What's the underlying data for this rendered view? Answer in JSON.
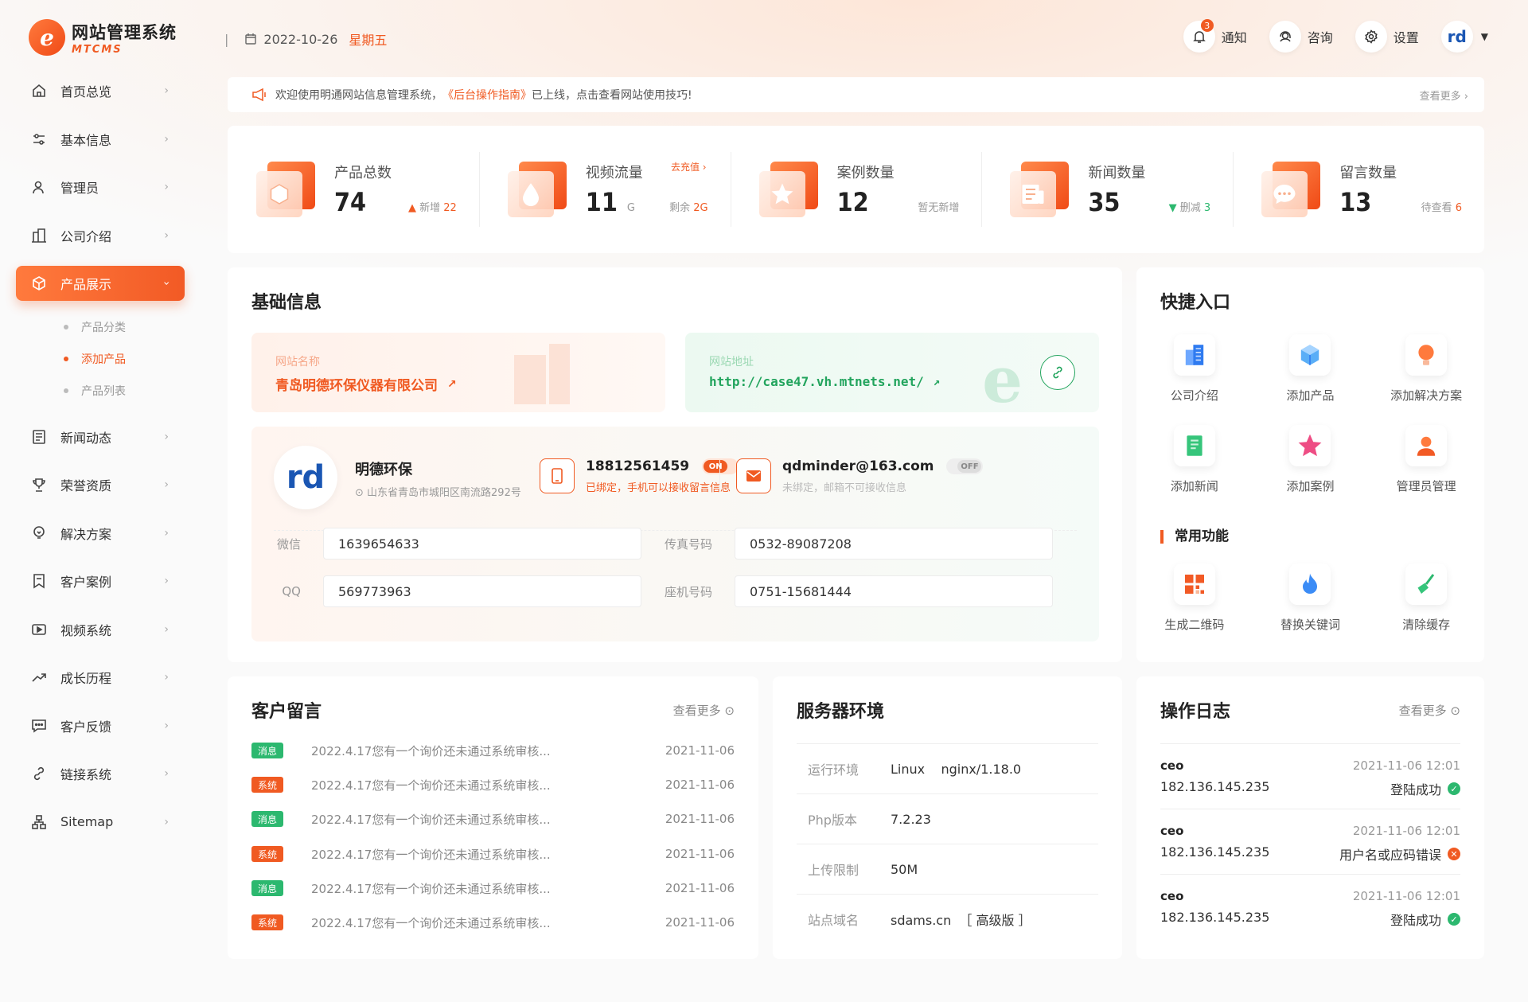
{
  "brand": {
    "title": "网站管理系统",
    "subtitle": "MTCMS",
    "mark": "e"
  },
  "sidebar": {
    "items": [
      {
        "label": "首页总览"
      },
      {
        "label": "基本信息"
      },
      {
        "label": "管理员"
      },
      {
        "label": "公司介绍"
      },
      {
        "label": "产品展示"
      },
      {
        "label": "新闻动态"
      },
      {
        "label": "荣誉资质"
      },
      {
        "label": "解决方案"
      },
      {
        "label": "客户案例"
      },
      {
        "label": "视频系统"
      },
      {
        "label": "成长历程"
      },
      {
        "label": "客户反馈"
      },
      {
        "label": "链接系统"
      },
      {
        "label": "Sitemap"
      }
    ],
    "sub_items": [
      {
        "label": "产品分类"
      },
      {
        "label": "添加产品"
      },
      {
        "label": "产品列表"
      }
    ]
  },
  "header": {
    "date": "2022-10-26",
    "weekday": "星期五",
    "notify_label": "通知",
    "notify_count": "3",
    "consult_label": "咨询",
    "settings_label": "设置",
    "avatar": "rd"
  },
  "notice": {
    "prefix": "欢迎使用明通网站信息管理系统，",
    "highlight": "《后台操作指南》",
    "suffix": "已上线，点击查看网站使用技巧!",
    "more": "查看更多"
  },
  "stats": [
    {
      "label": "产品总数",
      "value": "74",
      "unit": "",
      "side_label": "新增",
      "side_value": "22",
      "top_link": ""
    },
    {
      "label": "视频流量",
      "value": "11",
      "unit": "G",
      "side_label": "剩余",
      "side_value": "2G",
      "top_link": "去充值"
    },
    {
      "label": "案例数量",
      "value": "12",
      "unit": "",
      "side_label": "暂无新增",
      "side_value": "",
      "top_link": ""
    },
    {
      "label": "新闻数量",
      "value": "35",
      "unit": "",
      "side_label": "删减",
      "side_value": "3",
      "top_link": ""
    },
    {
      "label": "留言数量",
      "value": "13",
      "unit": "",
      "side_label": "待查看",
      "side_value": "6",
      "top_link": ""
    }
  ],
  "basic": {
    "title": "基础信息",
    "site_name_label": "网站名称",
    "site_name": "青岛明德环保仪器有限公司",
    "site_url_label": "网站地址",
    "site_url": "http://case47.vh.mtnets.net/",
    "company_logo": "rd",
    "company_name": "明德环保",
    "address": "山东省青岛市城阳区南流路292号",
    "phone": "18812561459",
    "phone_toggle": "ON",
    "phone_note": "已绑定，手机可以接收留言信息",
    "email": "qdminder@163.com",
    "email_toggle": "OFF",
    "email_note": "未绑定，邮箱不可接收信息",
    "fields": {
      "wechat_label": "微信",
      "wechat": "1639654633",
      "fax_label": "传真号码",
      "fax": "0532-89087208",
      "qq_label": "QQ",
      "qq": "569773963",
      "landline_label": "座机号码",
      "landline": "0751-15681444"
    }
  },
  "quick": {
    "title": "快捷入口",
    "items": [
      {
        "label": "公司介绍",
        "icon": "building-icon",
        "color": "#3b82f6"
      },
      {
        "label": "添加产品",
        "icon": "box-icon",
        "color": "#3b9cf6"
      },
      {
        "label": "添加解决方案",
        "icon": "bulb-icon",
        "color": "#f25a25"
      },
      {
        "label": "添加新闻",
        "icon": "document-icon",
        "color": "#2cb86f"
      },
      {
        "label": "添加案例",
        "icon": "star-icon",
        "color": "#ec4a7a"
      },
      {
        "label": "管理员管理",
        "icon": "user-icon",
        "color": "#f25a25"
      }
    ],
    "common_title": "常用功能",
    "common": [
      {
        "label": "生成二维码",
        "icon": "qrcode-icon",
        "color": "#f25a25"
      },
      {
        "label": "替换关键词",
        "icon": "flame-icon",
        "color": "#3b82f6"
      },
      {
        "label": "清除缓存",
        "icon": "broom-icon",
        "color": "#2cb86f"
      }
    ]
  },
  "messages": {
    "title": "客户留言",
    "more": "查看更多",
    "rows": [
      {
        "tag": "消息",
        "type": "green",
        "text": "2022.4.17您有一个询价还未通过系统审核...",
        "date": "2021-11-06"
      },
      {
        "tag": "系统",
        "type": "orange",
        "text": "2022.4.17您有一个询价还未通过系统审核...",
        "date": "2021-11-06"
      },
      {
        "tag": "消息",
        "type": "green",
        "text": "2022.4.17您有一个询价还未通过系统审核...",
        "date": "2021-11-06"
      },
      {
        "tag": "系统",
        "type": "orange",
        "text": "2022.4.17您有一个询价还未通过系统审核...",
        "date": "2021-11-06"
      },
      {
        "tag": "消息",
        "type": "green",
        "text": "2022.4.17您有一个询价还未通过系统审核...",
        "date": "2021-11-06"
      },
      {
        "tag": "系统",
        "type": "orange",
        "text": "2022.4.17您有一个询价还未通过系统审核...",
        "date": "2021-11-06"
      }
    ]
  },
  "server": {
    "title": "服务器环境",
    "rows": [
      {
        "key": "运行环境",
        "value": "Linux    nginx/1.18.0"
      },
      {
        "key": "Php版本",
        "value": "7.2.23"
      },
      {
        "key": "上传限制",
        "value": "50M"
      },
      {
        "key": "站点域名",
        "value": "sdams.cn  ［ 高级版 ］"
      }
    ]
  },
  "logs": {
    "title": "操作日志",
    "more": "查看更多",
    "rows": [
      {
        "user": "ceo",
        "time": "2021-11-06 12:01",
        "ip": "182.136.145.235",
        "status": "登陆成功",
        "ok": true
      },
      {
        "user": "ceo",
        "time": "2021-11-06 12:01",
        "ip": "182.136.145.235",
        "status": "用户名或应码错误",
        "ok": false
      },
      {
        "user": "ceo",
        "time": "2021-11-06 12:01",
        "ip": "182.136.145.235",
        "status": "登陆成功",
        "ok": true
      }
    ]
  },
  "colors": {
    "accent": "#f05a22",
    "success": "#2cb86f",
    "link": "#22a45d"
  }
}
